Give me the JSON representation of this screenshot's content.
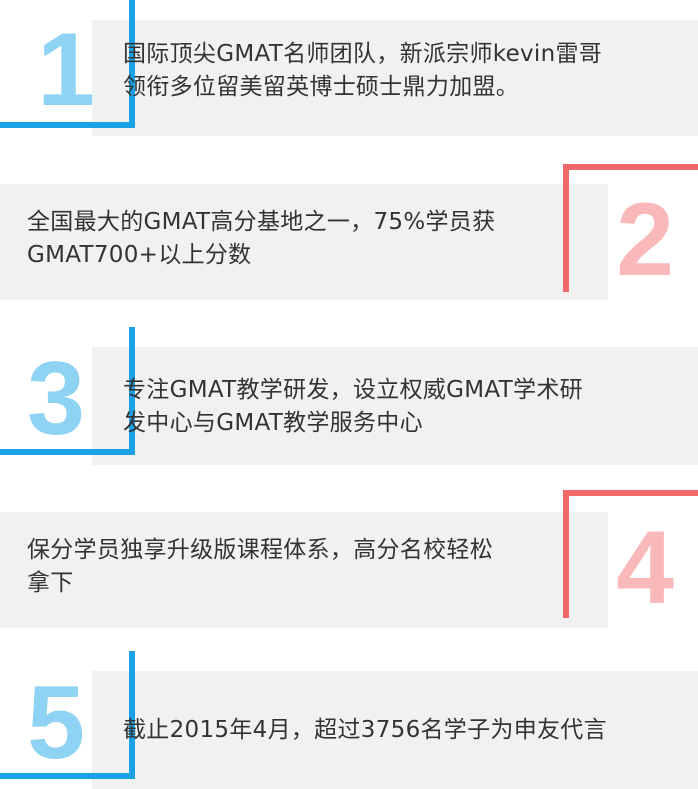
{
  "accent_colors": {
    "blue_frame": "#1aa1e6",
    "blue_number": "#8ed3f4",
    "red_frame": "#f2686a",
    "red_number": "#f9b8b9",
    "panel_background": "#f1f1f1",
    "text": "#333333"
  },
  "items": [
    {
      "number": "1",
      "line1": "国际顶尖GMAT名师团队，新派宗师kevin雷哥",
      "line2": "领衔多位留美留英博士硕士鼎力加盟。"
    },
    {
      "number": "2",
      "line1": "全国最大的GMAT高分基地之一，75%学员获",
      "line2": "GMAT700+以上分数"
    },
    {
      "number": "3",
      "line1": "专注GMAT教学研发，设立权威GMAT学术研",
      "line2": "发中心与GMAT教学服务中心"
    },
    {
      "number": "4",
      "line1": "保分学员独享升级版课程体系，高分名校轻松",
      "line2": "拿下"
    },
    {
      "number": "5",
      "line1": "截止2015年4月，超过3756名学子为申友代言",
      "line2": ""
    }
  ]
}
